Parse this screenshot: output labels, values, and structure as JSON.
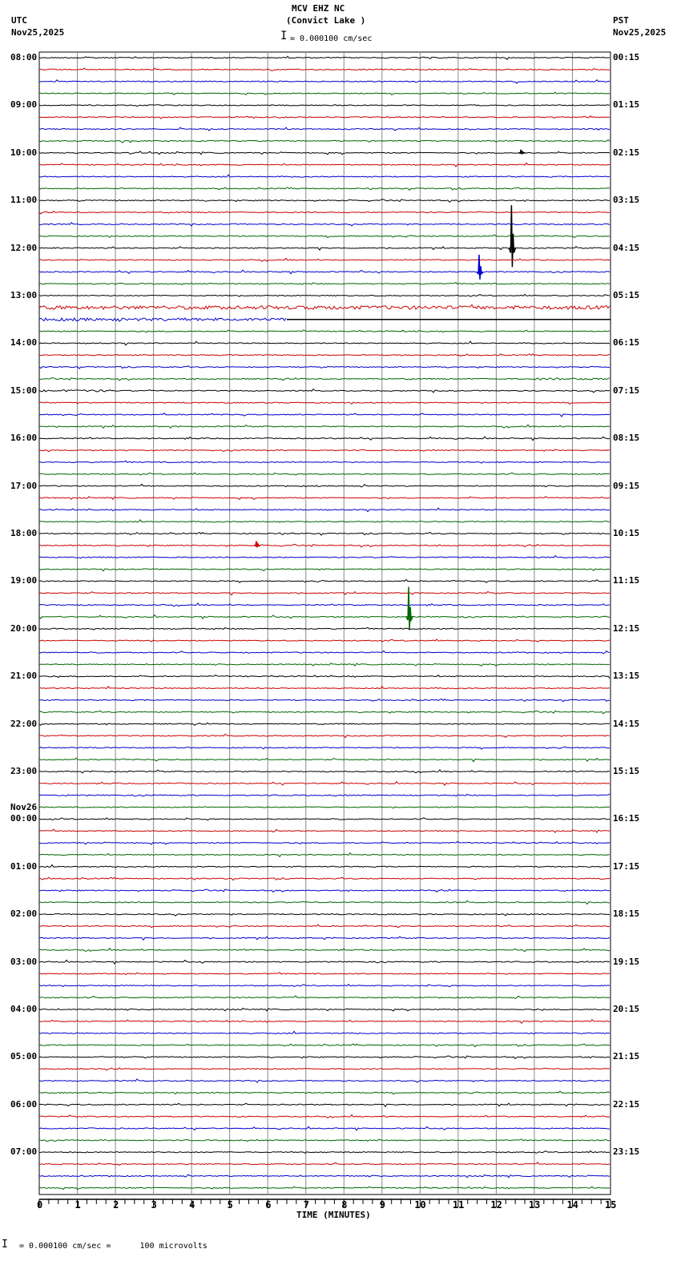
{
  "header": {
    "station": "MCV EHZ NC",
    "location": "(Convict Lake )",
    "left_tz": "UTC",
    "left_date": "Nov25,2025",
    "right_tz": "PST",
    "right_date": "Nov25,2025",
    "scale_text": "= 0.000100 cm/sec"
  },
  "footer": {
    "scale_text": "= 0.000100 cm/sec =      100 microvolts"
  },
  "chart_data": {
    "type": "line",
    "title": "MCV EHZ NC (Convict Lake )",
    "xlabel": "TIME (MINUTES)",
    "xlim": [
      0,
      15
    ],
    "x_ticks": [
      "0",
      "1",
      "2",
      "3",
      "4",
      "5",
      "6",
      "7",
      "8",
      "9",
      "10",
      "11",
      "12",
      "13",
      "14",
      "15"
    ],
    "minor_tick_step_min": 0.25,
    "rows_per_hour": 4,
    "row_count": 96,
    "trace_colors": [
      "#000000",
      "#cc0000",
      "#0000cc",
      "#006600"
    ],
    "left_labels": [
      "08:00",
      "09:00",
      "10:00",
      "11:00",
      "12:00",
      "13:00",
      "14:00",
      "15:00",
      "16:00",
      "17:00",
      "18:00",
      "19:00",
      "20:00",
      "21:00",
      "22:00",
      "23:00",
      "00:00",
      "01:00",
      "02:00",
      "03:00",
      "04:00",
      "05:00",
      "06:00",
      "07:00"
    ],
    "date_change_label": "Nov26",
    "right_labels": [
      "00:15",
      "01:15",
      "02:15",
      "03:15",
      "04:15",
      "05:15",
      "06:15",
      "07:15",
      "08:15",
      "09:15",
      "10:15",
      "11:15",
      "12:15",
      "13:15",
      "14:15",
      "15:15",
      "16:15",
      "17:15",
      "18:15",
      "19:15",
      "20:15",
      "21:15",
      "22:15",
      "23:15"
    ],
    "events": [
      {
        "row": 16,
        "minute": 12.4,
        "amplitude": 4.0
      },
      {
        "row": 18,
        "minute": 11.55,
        "amplitude": 1.6
      },
      {
        "row": 47,
        "minute": 9.7,
        "amplitude": 2.8
      },
      {
        "row": 41,
        "minute": 5.7,
        "amplitude": 0.4
      },
      {
        "row": 8,
        "minute": 12.65,
        "amplitude": 0.3
      }
    ],
    "noisy_rows": [
      {
        "row": 21,
        "level": 2.2
      },
      {
        "row": 22,
        "level": 1.8,
        "until_minute": 6.5
      },
      {
        "row": 27,
        "level": 1.2,
        "from_minute": 13
      },
      {
        "row": 28,
        "level": 1.3,
        "until_minute": 2
      }
    ],
    "flat_segments": [
      {
        "row": 22,
        "from_minute": 6.5
      }
    ]
  }
}
